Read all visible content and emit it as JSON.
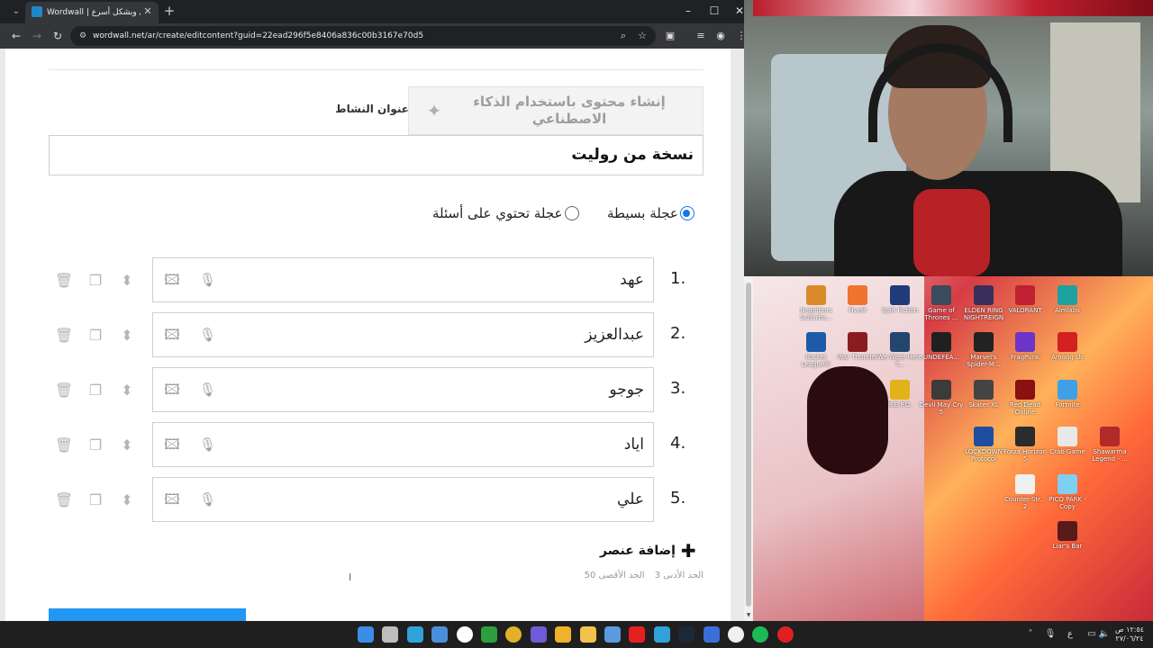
{
  "browser": {
    "tab_title": "Wordwall | أفضل وبشكل أسرع",
    "url": "wordwall.net/ar/create/editcontent?guid=22ead296f5e8406a836c00b3167e70d5",
    "window_buttons": {
      "minimize": "–",
      "maximize": "☐",
      "close": "✕"
    }
  },
  "editor": {
    "ai_button_label": "إنشاء محتوى باستخدام الذكاء الاصطناعي",
    "title_label": "عنوان النشاط",
    "title_value": "نسخة من روليت",
    "wheel_options": [
      {
        "label": "عجلة بسيطة",
        "selected": true
      },
      {
        "label": "عجلة تحتوي على أسئلة",
        "selected": false
      }
    ],
    "items": [
      {
        "number": "1.",
        "text": "عهد"
      },
      {
        "number": "2.",
        "text": "عبدالعزيز"
      },
      {
        "number": "3.",
        "text": "جوجو"
      },
      {
        "number": "4.",
        "text": "اياد"
      },
      {
        "number": "5.",
        "text": "علي"
      }
    ],
    "add_item_label": "إضافة عنصر",
    "min_label": "الحد الأدنى 3",
    "max_label": "الحد الأقصى 50",
    "accent_color": "#2196f3"
  },
  "desktop": {
    "icons": [
      {
        "label": "Neighbors Suburba...",
        "color": "#d98b2a"
      },
      {
        "label": "FiveM",
        "color": "#f0732f"
      },
      {
        "label": "Split Fiction",
        "color": "#1f3b7a"
      },
      {
        "label": "Game of Thrones ...",
        "color": "#3b4a5c"
      },
      {
        "label": "ELDEN RING NIGHTREIGN",
        "color": "#3a2f5c"
      },
      {
        "label": "VALORANT",
        "color": "#c0202f"
      },
      {
        "label": "Aimlabs",
        "color": "#1aa1a0"
      },
      {
        "label": "Rocket League®",
        "color": "#1e5aa8"
      },
      {
        "label": "War Thunder",
        "color": "#8a1e1e"
      },
      {
        "label": "We Were Here T...",
        "color": "#23456e"
      },
      {
        "label": "UNDEFEA...",
        "color": "#202020"
      },
      {
        "label": "Marvel's Spider-M...",
        "color": "#222"
      },
      {
        "label": "FragPunk",
        "color": "#6d34c8"
      },
      {
        "label": "Among Us",
        "color": "#d32020"
      },
      {
        "label": "R.E.P.O.",
        "color": "#e2b21a"
      },
      {
        "label": "Devil May Cry 5",
        "color": "#3b3b3b"
      },
      {
        "label": "Skater XL",
        "color": "#444"
      },
      {
        "label": "Red Dead Online",
        "color": "#8b1010"
      },
      {
        "label": "Fortnite",
        "color": "#3fa0e8"
      },
      {
        "label": "LOCKDOWN Protocol",
        "color": "#1e4ea0"
      },
      {
        "label": "Forza Horizon 5",
        "color": "#2c2c2c"
      },
      {
        "label": "Crab Game",
        "color": "#e8e8e8"
      },
      {
        "label": "Shawarma Legend - ...",
        "color": "#b02a2a"
      },
      {
        "label": "Counter-Str... 2",
        "color": "#f0f0f0"
      },
      {
        "label": "PICO PARK - Copy",
        "color": "#7fd0f0"
      },
      {
        "label": "Liar's Bar",
        "color": "#5a1a1a"
      }
    ]
  },
  "taskbar": {
    "clock_time": "١٢:٥٤ ص",
    "clock_date": "٢٧/٠٦/٢٤",
    "lang": "ع",
    "apps": [
      {
        "name": "start",
        "color": "#3a8ee6"
      },
      {
        "name": "task-view",
        "color": "#bdbdbd"
      },
      {
        "name": "edge",
        "color": "#2fa3d9"
      },
      {
        "name": "store",
        "color": "#4a8fd9"
      },
      {
        "name": "widget",
        "color": "#ffffff"
      },
      {
        "name": "xbox",
        "color": "#2e9e3e"
      },
      {
        "name": "chrome",
        "color": "#e3b02a"
      },
      {
        "name": "discord-ptb",
        "color": "#6f5bd8"
      },
      {
        "name": "discord",
        "color": "#f0b22a"
      },
      {
        "name": "files",
        "color": "#f2c34b"
      },
      {
        "name": "photos",
        "color": "#5a9ae0"
      },
      {
        "name": "youtube",
        "color": "#e62020"
      },
      {
        "name": "telegram",
        "color": "#2fa3d9"
      },
      {
        "name": "steam",
        "color": "#1b2838"
      },
      {
        "name": "app-blue",
        "color": "#3a6fd9"
      },
      {
        "name": "obs",
        "color": "#f0f0f0"
      },
      {
        "name": "spotify",
        "color": "#1db954"
      },
      {
        "name": "app-red",
        "color": "#e02020"
      }
    ]
  }
}
